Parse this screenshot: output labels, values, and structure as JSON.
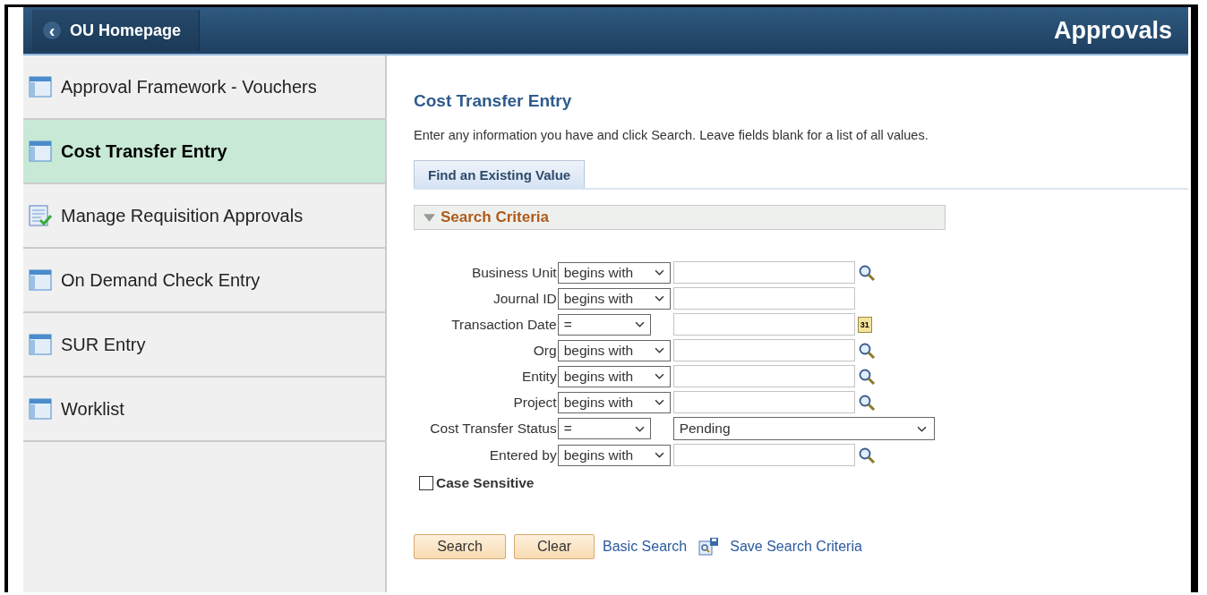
{
  "header": {
    "back_button": {
      "icon": "‹",
      "label": "OU Homepage"
    },
    "title": "Approvals"
  },
  "sidebar": {
    "items": [
      {
        "label": "Approval Framework - Vouchers",
        "kind": "page",
        "selected": false
      },
      {
        "label": "Cost Transfer Entry",
        "kind": "page",
        "selected": true
      },
      {
        "label": "Manage Requisition Approvals",
        "kind": "approval",
        "selected": false
      },
      {
        "label": "On Demand Check Entry",
        "kind": "page",
        "selected": false
      },
      {
        "label": "SUR Entry",
        "kind": "page",
        "selected": false
      },
      {
        "label": "Worklist",
        "kind": "page",
        "selected": false
      }
    ]
  },
  "main": {
    "title": "Cost Transfer Entry",
    "instructions": "Enter any information you have and click Search. Leave fields blank for a list of all values.",
    "tabs": [
      {
        "label": "Find an Existing Value",
        "selected": true
      }
    ],
    "section": {
      "title": "Search Criteria",
      "expanded": true
    },
    "fields": [
      {
        "label": "Business Unit",
        "operator": "begins with",
        "kind": "lookup"
      },
      {
        "label": "Journal ID",
        "operator": "begins with",
        "kind": "plain"
      },
      {
        "label": "Transaction Date",
        "operator": "=",
        "kind": "date",
        "calendar_icon": "31"
      },
      {
        "label": "Org",
        "operator": "begins with",
        "kind": "lookup"
      },
      {
        "label": "Entity",
        "operator": "begins with",
        "kind": "lookup"
      },
      {
        "label": "Project",
        "operator": "begins with",
        "kind": "lookup"
      },
      {
        "label": "Cost Transfer Status",
        "operator": "=",
        "kind": "dropdown",
        "value": "Pending"
      },
      {
        "label": "Entered by",
        "operator": "begins with",
        "kind": "lookup"
      }
    ],
    "case_sensitive": {
      "label": "Case Sensitive",
      "checked": false
    },
    "buttons": [
      "Search",
      "Clear"
    ],
    "links": {
      "basic_search": "Basic Search",
      "save_criteria": "Save Search Criteria"
    }
  }
}
